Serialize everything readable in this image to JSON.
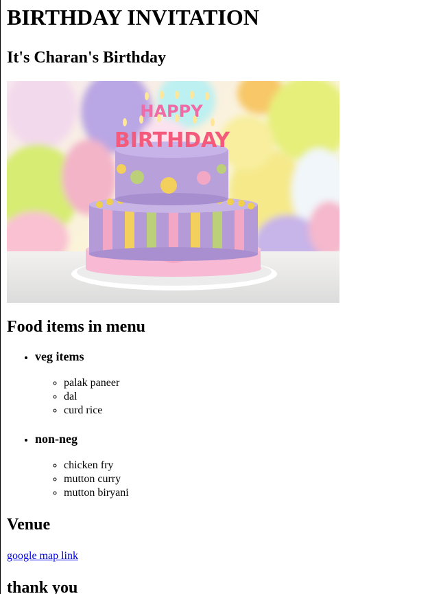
{
  "page": {
    "title": "BIRTHDAY INVITATION",
    "subtitle": "It's Charan's Birthday"
  },
  "image": {
    "name": "birthday-cake-image",
    "candle_text": "HAPPY BIRTHDAY",
    "colors": {
      "balloon_yellow": "#e6ef7a",
      "balloon_purple": "#b9a6e4",
      "balloon_pink": "#f3b4c8",
      "balloon_orange": "#f7c768",
      "cake_purple": "#b49bd8",
      "cake_pink": "#f2a8c4",
      "cake_yellow": "#f3cf5c",
      "cake_green": "#bcd07a"
    }
  },
  "menu": {
    "heading": "Food items in menu",
    "groups": [
      {
        "label": "veg items",
        "items": [
          "palak paneer",
          "dal",
          "curd rice"
        ]
      },
      {
        "label": "non-neg",
        "items": [
          "chicken fry",
          "mutton curry",
          "mutton biryani"
        ]
      }
    ]
  },
  "venue": {
    "heading": "Venue",
    "link_text": "google map link"
  },
  "closing": {
    "text": "thank you"
  }
}
